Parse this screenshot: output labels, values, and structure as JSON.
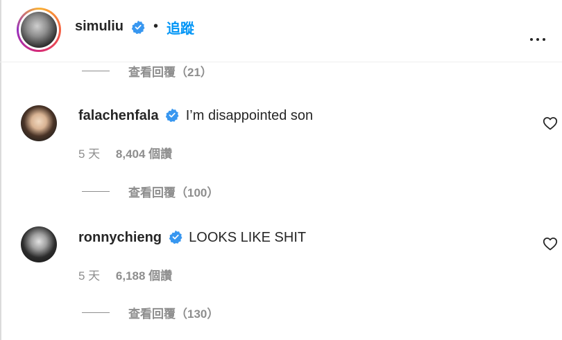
{
  "header": {
    "username": "simuliu",
    "separator": "•",
    "follow_label": "追蹤"
  },
  "reply_threads": [
    {
      "label": "查看回覆（21）"
    },
    {
      "label": "查看回覆（100）"
    },
    {
      "label": "查看回覆（130）"
    }
  ],
  "comments": [
    {
      "username": "falachenfala",
      "text": "I’m disappointed son",
      "time": "5 天",
      "views": "8,404 個讚"
    },
    {
      "username": "ronnychieng",
      "text": "LOOKS LIKE SHIT",
      "time": "5 天",
      "views": "6,188 個讚"
    }
  ],
  "colors": {
    "link": "#0095f6",
    "verified": "#3897f0",
    "muted": "#8e8e8e",
    "text": "#262626"
  },
  "icons": [
    "verified-badge-icon",
    "more-options-icon",
    "heart-icon"
  ]
}
